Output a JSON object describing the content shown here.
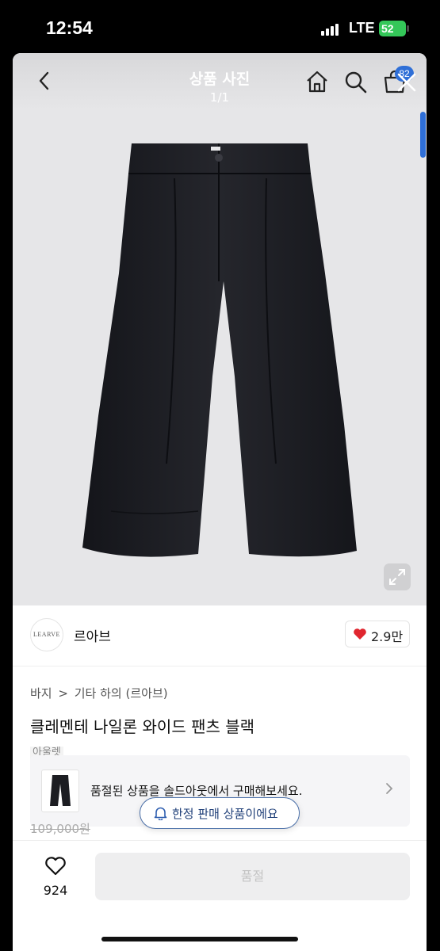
{
  "status_bar": {
    "time": "12:54",
    "network": "LTE",
    "battery": "52"
  },
  "photo_viewer": {
    "title": "상품 사진",
    "counter": "1/1",
    "cart_badge": "82",
    "background_color": "#e6e6e8",
    "product_color": "#1c1d22",
    "icons": [
      "back-icon",
      "home-icon",
      "search-icon",
      "shopping-bag-icon",
      "close-icon",
      "expand-icon"
    ]
  },
  "brand": {
    "logo_text": "LEARVE",
    "name": "르아브",
    "likes": "2.9만"
  },
  "product": {
    "breadcrumb": [
      "바지",
      "기타 하의 (르아브)"
    ],
    "breadcrumb_separator": ">",
    "title": "클레멘테 나일론 와이드 팬츠 블랙",
    "badge": "아울렛",
    "original_price": "109,000원"
  },
  "soldout_banner": {
    "text": "품절된 상품을 솔드아웃에서 구매해보세요."
  },
  "tooltip": {
    "text": "한정 판매 상품이에요"
  },
  "bottom_bar": {
    "wish_count": "924",
    "buy_button_label": "품절"
  },
  "colors": {
    "like_heart": "#e0262f",
    "badge_blue": "#2f6fd7",
    "battery_green": "#34c759"
  }
}
